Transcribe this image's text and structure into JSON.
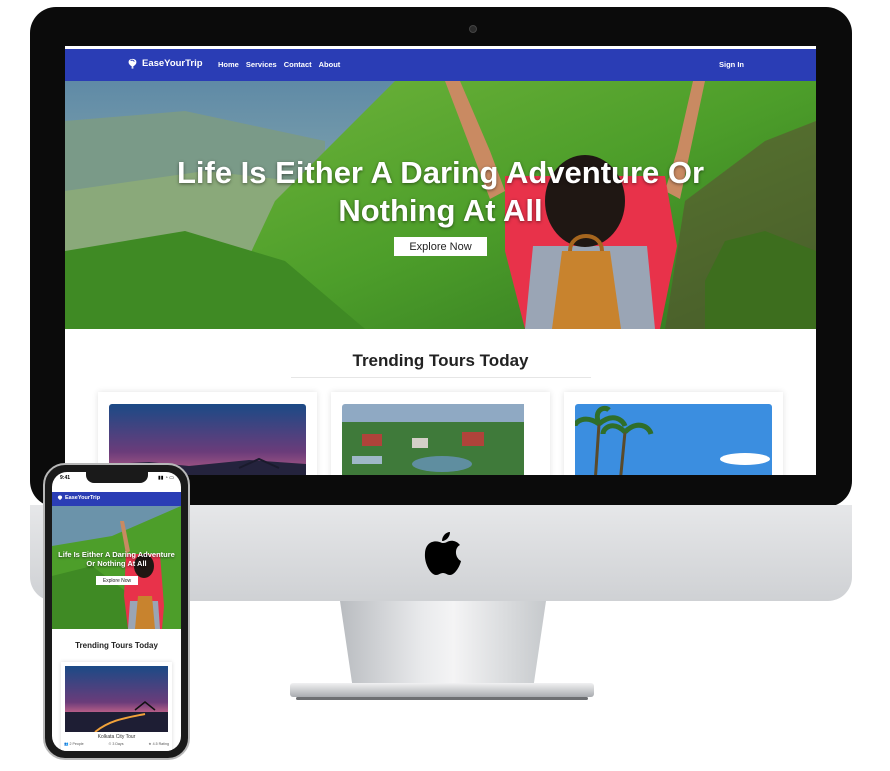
{
  "desktop": {
    "brand": "EaseYourTrip",
    "nav": {
      "links": [
        "Home",
        "Services",
        "Contact",
        "About"
      ],
      "sign_in": "Sign In"
    },
    "hero": {
      "title_line1": "Life Is Either A Daring Adventure Or",
      "title_line2": "Nothing At All",
      "button": "Explore Now"
    },
    "trending": {
      "title": "Trending Tours Today"
    }
  },
  "mobile": {
    "status_time": "9:41",
    "brand": "EaseYourTrip",
    "hero": {
      "title_line1": "Life Is Either A Daring Adventure",
      "title_line2": "Or Nothing At All",
      "button": "Explore Now"
    },
    "trending": {
      "title": "Trending Tours Today"
    },
    "card": {
      "name": "Kolkata City Tour",
      "people": "2 People",
      "days": "3 Days",
      "rating": "4.5 Rating"
    }
  },
  "colors": {
    "nav": "#2a3db5",
    "hero_green": "#4d9e2a",
    "shirt": "#e8324a"
  },
  "icons": {
    "brand": "hot-air-balloon-icon",
    "apple": "apple-logo-icon"
  }
}
